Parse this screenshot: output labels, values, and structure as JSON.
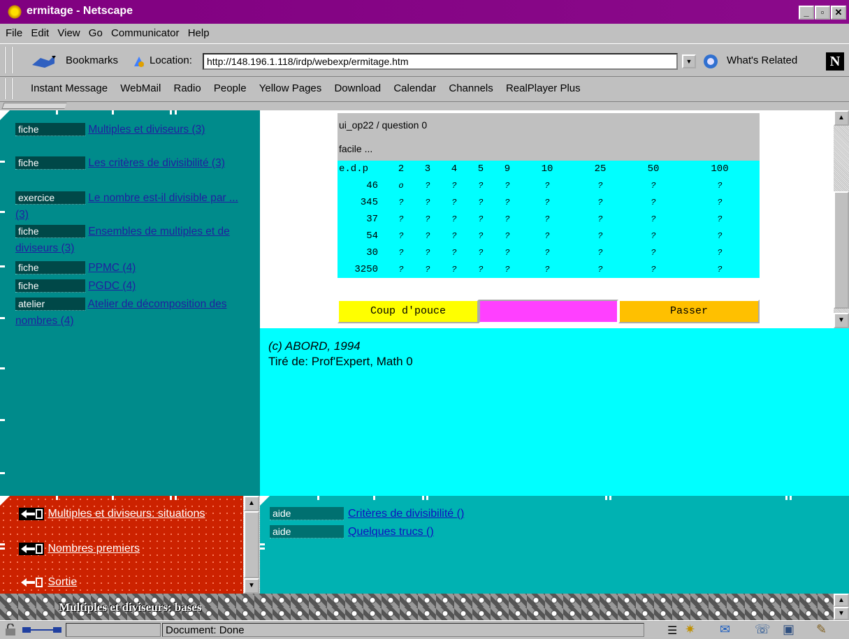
{
  "window": {
    "title": "ermitage - Netscape"
  },
  "menu": [
    "File",
    "Edit",
    "View",
    "Go",
    "Communicator",
    "Help"
  ],
  "toolbar": {
    "bookmarks": "Bookmarks",
    "location_label": "Location:",
    "url": "http://148.196.1.118/irdp/webexp/ermitage.htm",
    "whats_related": "What's Related"
  },
  "personal_toolbar": [
    "Instant Message",
    "WebMail",
    "Radio",
    "People",
    "Yellow Pages",
    "Download",
    "Calendar",
    "Channels",
    "RealPlayer Plus"
  ],
  "left_entries": [
    {
      "type": "fiche",
      "link": "Multiples et diviseurs (3)"
    },
    {
      "type": "fiche",
      "link": "Les critères de divisibilité (3)"
    },
    {
      "type": "exercice",
      "link": "Le nombre est-il divisible par ... (3)"
    },
    {
      "type": "fiche",
      "link": "Ensembles de multiples et de diviseurs (3)"
    },
    {
      "type": "fiche",
      "link": "PPMC (4)"
    },
    {
      "type": "fiche",
      "link": "PGDC (4)"
    },
    {
      "type": "atelier",
      "link": "Atelier de décomposition des nombres (4)"
    }
  ],
  "quiz": {
    "title": "ui_op22 / question 0",
    "level": "facile ...",
    "header": [
      "e.d.p",
      "2",
      "3",
      "4",
      "5",
      "9",
      "10",
      "25",
      "50",
      "100"
    ],
    "rows": [
      {
        "n": "46",
        "cells": [
          "o",
          "?",
          "?",
          "?",
          "?",
          "?",
          "?",
          "?",
          "?"
        ]
      },
      {
        "n": "345",
        "cells": [
          "?",
          "?",
          "?",
          "?",
          "?",
          "?",
          "?",
          "?",
          "?"
        ]
      },
      {
        "n": "37",
        "cells": [
          "?",
          "?",
          "?",
          "?",
          "?",
          "?",
          "?",
          "?",
          "?"
        ]
      },
      {
        "n": "54",
        "cells": [
          "?",
          "?",
          "?",
          "?",
          "?",
          "?",
          "?",
          "?",
          "?"
        ]
      },
      {
        "n": "30",
        "cells": [
          "?",
          "?",
          "?",
          "?",
          "?",
          "?",
          "?",
          "?",
          "?"
        ]
      },
      {
        "n": "3250",
        "cells": [
          "?",
          "?",
          "?",
          "?",
          "?",
          "?",
          "?",
          "?",
          "?"
        ]
      }
    ],
    "hint_button": "Coup d'pouce",
    "skip_button": "Passer"
  },
  "credits": {
    "line1": "(c) ABORD, 1994",
    "line2": "Tiré de: Prof'Expert, Math 0"
  },
  "nav": {
    "item1": "Multiples et diviseurs: situations",
    "item2": "Nombres premiers",
    "exit": "Sortie"
  },
  "help": [
    {
      "type": "aide",
      "link": "Critères de divisibilité ()"
    },
    {
      "type": "aide",
      "link": "Quelques trucs ()"
    }
  ],
  "section_title": "Multiples et diviseurs: bases",
  "status": {
    "text": "Document: Done"
  },
  "colors": {
    "title_bar": "#800080",
    "left_frame": "#008b8b",
    "credits_bg": "#00ffff",
    "nav_bg": "#cc2200",
    "help_bg": "#00b2b2",
    "hint_btn": "#ffff00",
    "skip_btn": "#ffc000",
    "middle_btn": "#ff40ff"
  }
}
